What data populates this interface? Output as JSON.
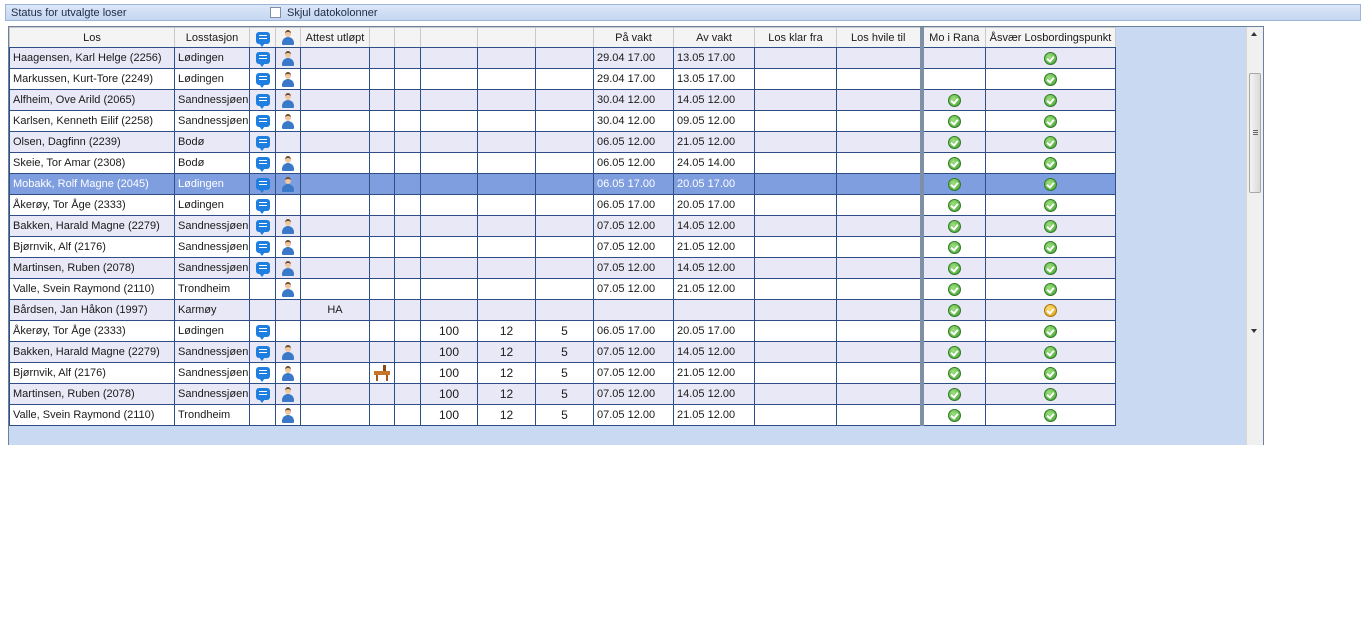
{
  "header": {
    "title": "Status for utvalgte loser",
    "hide_date_columns_label": "Skjul datokolonner",
    "hide_date_columns_checked": false
  },
  "columns": {
    "los": "Los",
    "losstasjon": "Losstasjon",
    "attest": "Attest utløpt",
    "blank1": "",
    "blank2": "",
    "blank3": "",
    "blank4": "",
    "blank5": "",
    "pa_vakt": "På vakt",
    "av_vakt": "Av vakt",
    "klar_fra": "Los klar fra",
    "hvile_til": "Los hvile til",
    "mo_i_rana": "Mo i Rana",
    "asvaer": "Åsvær Losbordingspunkt"
  },
  "rows": [
    {
      "los": "Haagensen, Karl Helge (2256)",
      "station": "Lødingen",
      "chat": true,
      "user": true,
      "attest": "",
      "rig": false,
      "n1": "",
      "n2": "",
      "n3": "",
      "pa": "29.04 17.00",
      "av": "13.05 17.00",
      "mo": "",
      "asv": "ok",
      "style": "alt"
    },
    {
      "los": "Markussen, Kurt-Tore (2249)",
      "station": "Lødingen",
      "chat": true,
      "user": true,
      "attest": "",
      "rig": false,
      "n1": "",
      "n2": "",
      "n3": "",
      "pa": "29.04 17.00",
      "av": "13.05 17.00",
      "mo": "",
      "asv": "ok",
      "style": "norm"
    },
    {
      "los": "Alfheim, Ove Arild (2065)",
      "station": "Sandnessjøen",
      "chat": true,
      "user": true,
      "attest": "",
      "rig": false,
      "n1": "",
      "n2": "",
      "n3": "",
      "pa": "30.04 12.00",
      "av": "14.05 12.00",
      "mo": "ok",
      "asv": "ok",
      "style": "alt"
    },
    {
      "los": "Karlsen, Kenneth Eilif (2258)",
      "station": "Sandnessjøen",
      "chat": true,
      "user": true,
      "attest": "",
      "rig": false,
      "n1": "",
      "n2": "",
      "n3": "",
      "pa": "30.04 12.00",
      "av": "09.05 12.00",
      "mo": "ok",
      "asv": "ok",
      "style": "norm"
    },
    {
      "los": "Olsen, Dagfinn (2239)",
      "station": "Bodø",
      "chat": true,
      "user": false,
      "attest": "",
      "rig": false,
      "n1": "",
      "n2": "",
      "n3": "",
      "pa": "06.05 12.00",
      "av": "21.05 12.00",
      "mo": "ok",
      "asv": "ok",
      "style": "alt"
    },
    {
      "los": "Skeie, Tor Amar (2308)",
      "station": "Bodø",
      "chat": true,
      "user": true,
      "attest": "",
      "rig": false,
      "n1": "",
      "n2": "",
      "n3": "",
      "pa": "06.05 12.00",
      "av": "24.05 14.00",
      "mo": "ok",
      "asv": "ok",
      "style": "norm"
    },
    {
      "los": "Mobakk, Rolf Magne (2045)",
      "station": "Lødingen",
      "chat": true,
      "user": true,
      "attest": "",
      "rig": false,
      "n1": "",
      "n2": "",
      "n3": "",
      "pa": "06.05 17.00",
      "av": "20.05 17.00",
      "mo": "ok",
      "asv": "ok",
      "style": "sel"
    },
    {
      "los": "Åkerøy, Tor Åge (2333)",
      "station": "Lødingen",
      "chat": true,
      "user": false,
      "attest": "",
      "rig": false,
      "n1": "",
      "n2": "",
      "n3": "",
      "pa": "06.05 17.00",
      "av": "20.05 17.00",
      "mo": "ok",
      "asv": "ok",
      "style": "norm"
    },
    {
      "los": "Bakken, Harald Magne (2279)",
      "station": "Sandnessjøen",
      "chat": true,
      "user": true,
      "attest": "",
      "rig": false,
      "n1": "",
      "n2": "",
      "n3": "",
      "pa": "07.05 12.00",
      "av": "14.05 12.00",
      "mo": "ok",
      "asv": "ok",
      "style": "alt"
    },
    {
      "los": "Bjørnvik, Alf (2176)",
      "station": "Sandnessjøen",
      "chat": true,
      "user": true,
      "attest": "",
      "rig": false,
      "n1": "",
      "n2": "",
      "n3": "",
      "pa": "07.05 12.00",
      "av": "21.05 12.00",
      "mo": "ok",
      "asv": "ok",
      "style": "norm"
    },
    {
      "los": "Martinsen, Ruben (2078)",
      "station": "Sandnessjøen",
      "chat": true,
      "user": true,
      "attest": "",
      "rig": false,
      "n1": "",
      "n2": "",
      "n3": "",
      "pa": "07.05 12.00",
      "av": "14.05 12.00",
      "mo": "ok",
      "asv": "ok",
      "style": "alt"
    },
    {
      "los": "Valle, Svein Raymond (2110)",
      "station": "Trondheim",
      "chat": false,
      "user": true,
      "attest": "",
      "rig": false,
      "n1": "",
      "n2": "",
      "n3": "",
      "pa": "07.05 12.00",
      "av": "21.05 12.00",
      "mo": "ok",
      "asv": "ok",
      "style": "norm"
    },
    {
      "los": "Bårdsen, Jan Håkon (1997)",
      "station": "Karmøy",
      "chat": false,
      "user": false,
      "attest": "HA",
      "rig": false,
      "n1": "",
      "n2": "",
      "n3": "",
      "pa": "",
      "av": "",
      "mo": "ok",
      "asv": "warn",
      "style": "alt"
    },
    {
      "los": "Åkerøy, Tor Åge (2333)",
      "station": "Lødingen",
      "chat": true,
      "user": false,
      "attest": "",
      "rig": false,
      "n1": "100",
      "n2": "12",
      "n3": "5",
      "pa": "06.05 17.00",
      "av": "20.05 17.00",
      "mo": "ok",
      "asv": "ok",
      "style": "norm"
    },
    {
      "los": "Bakken, Harald Magne (2279)",
      "station": "Sandnessjøen",
      "chat": true,
      "user": true,
      "attest": "",
      "rig": false,
      "n1": "100",
      "n2": "12",
      "n3": "5",
      "pa": "07.05 12.00",
      "av": "14.05 12.00",
      "mo": "ok",
      "asv": "ok",
      "style": "alt"
    },
    {
      "los": "Bjørnvik, Alf (2176)",
      "station": "Sandnessjøen",
      "chat": true,
      "user": true,
      "attest": "",
      "rig": true,
      "n1": "100",
      "n2": "12",
      "n3": "5",
      "pa": "07.05 12.00",
      "av": "21.05 12.00",
      "mo": "ok",
      "asv": "ok",
      "style": "norm"
    },
    {
      "los": "Martinsen, Ruben (2078)",
      "station": "Sandnessjøen",
      "chat": true,
      "user": true,
      "attest": "",
      "rig": false,
      "n1": "100",
      "n2": "12",
      "n3": "5",
      "pa": "07.05 12.00",
      "av": "14.05 12.00",
      "mo": "ok",
      "asv": "ok",
      "style": "alt"
    },
    {
      "los": "Valle, Svein Raymond (2110)",
      "station": "Trondheim",
      "chat": false,
      "user": true,
      "attest": "",
      "rig": false,
      "n1": "100",
      "n2": "12",
      "n3": "5",
      "pa": "07.05 12.00",
      "av": "21.05 12.00",
      "mo": "ok",
      "asv": "ok",
      "style": "norm"
    }
  ]
}
